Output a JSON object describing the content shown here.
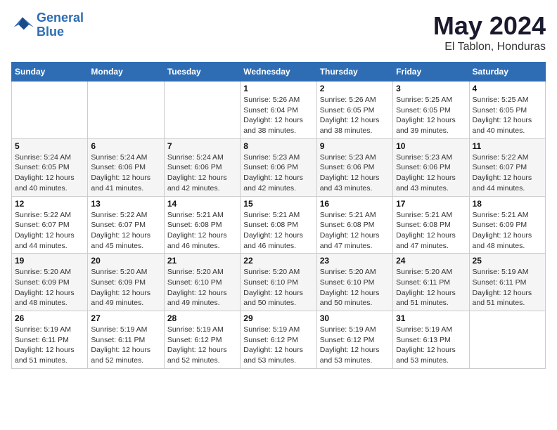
{
  "logo": {
    "line1": "General",
    "line2": "Blue"
  },
  "title": "May 2024",
  "location": "El Tablon, Honduras",
  "weekdays": [
    "Sunday",
    "Monday",
    "Tuesday",
    "Wednesday",
    "Thursday",
    "Friday",
    "Saturday"
  ],
  "weeks": [
    [
      {
        "day": "",
        "info": ""
      },
      {
        "day": "",
        "info": ""
      },
      {
        "day": "",
        "info": ""
      },
      {
        "day": "1",
        "info": "Sunrise: 5:26 AM\nSunset: 6:04 PM\nDaylight: 12 hours\nand 38 minutes."
      },
      {
        "day": "2",
        "info": "Sunrise: 5:26 AM\nSunset: 6:05 PM\nDaylight: 12 hours\nand 38 minutes."
      },
      {
        "day": "3",
        "info": "Sunrise: 5:25 AM\nSunset: 6:05 PM\nDaylight: 12 hours\nand 39 minutes."
      },
      {
        "day": "4",
        "info": "Sunrise: 5:25 AM\nSunset: 6:05 PM\nDaylight: 12 hours\nand 40 minutes."
      }
    ],
    [
      {
        "day": "5",
        "info": "Sunrise: 5:24 AM\nSunset: 6:05 PM\nDaylight: 12 hours\nand 40 minutes."
      },
      {
        "day": "6",
        "info": "Sunrise: 5:24 AM\nSunset: 6:06 PM\nDaylight: 12 hours\nand 41 minutes."
      },
      {
        "day": "7",
        "info": "Sunrise: 5:24 AM\nSunset: 6:06 PM\nDaylight: 12 hours\nand 42 minutes."
      },
      {
        "day": "8",
        "info": "Sunrise: 5:23 AM\nSunset: 6:06 PM\nDaylight: 12 hours\nand 42 minutes."
      },
      {
        "day": "9",
        "info": "Sunrise: 5:23 AM\nSunset: 6:06 PM\nDaylight: 12 hours\nand 43 minutes."
      },
      {
        "day": "10",
        "info": "Sunrise: 5:23 AM\nSunset: 6:06 PM\nDaylight: 12 hours\nand 43 minutes."
      },
      {
        "day": "11",
        "info": "Sunrise: 5:22 AM\nSunset: 6:07 PM\nDaylight: 12 hours\nand 44 minutes."
      }
    ],
    [
      {
        "day": "12",
        "info": "Sunrise: 5:22 AM\nSunset: 6:07 PM\nDaylight: 12 hours\nand 44 minutes."
      },
      {
        "day": "13",
        "info": "Sunrise: 5:22 AM\nSunset: 6:07 PM\nDaylight: 12 hours\nand 45 minutes."
      },
      {
        "day": "14",
        "info": "Sunrise: 5:21 AM\nSunset: 6:08 PM\nDaylight: 12 hours\nand 46 minutes."
      },
      {
        "day": "15",
        "info": "Sunrise: 5:21 AM\nSunset: 6:08 PM\nDaylight: 12 hours\nand 46 minutes."
      },
      {
        "day": "16",
        "info": "Sunrise: 5:21 AM\nSunset: 6:08 PM\nDaylight: 12 hours\nand 47 minutes."
      },
      {
        "day": "17",
        "info": "Sunrise: 5:21 AM\nSunset: 6:08 PM\nDaylight: 12 hours\nand 47 minutes."
      },
      {
        "day": "18",
        "info": "Sunrise: 5:21 AM\nSunset: 6:09 PM\nDaylight: 12 hours\nand 48 minutes."
      }
    ],
    [
      {
        "day": "19",
        "info": "Sunrise: 5:20 AM\nSunset: 6:09 PM\nDaylight: 12 hours\nand 48 minutes."
      },
      {
        "day": "20",
        "info": "Sunrise: 5:20 AM\nSunset: 6:09 PM\nDaylight: 12 hours\nand 49 minutes."
      },
      {
        "day": "21",
        "info": "Sunrise: 5:20 AM\nSunset: 6:10 PM\nDaylight: 12 hours\nand 49 minutes."
      },
      {
        "day": "22",
        "info": "Sunrise: 5:20 AM\nSunset: 6:10 PM\nDaylight: 12 hours\nand 50 minutes."
      },
      {
        "day": "23",
        "info": "Sunrise: 5:20 AM\nSunset: 6:10 PM\nDaylight: 12 hours\nand 50 minutes."
      },
      {
        "day": "24",
        "info": "Sunrise: 5:20 AM\nSunset: 6:11 PM\nDaylight: 12 hours\nand 51 minutes."
      },
      {
        "day": "25",
        "info": "Sunrise: 5:19 AM\nSunset: 6:11 PM\nDaylight: 12 hours\nand 51 minutes."
      }
    ],
    [
      {
        "day": "26",
        "info": "Sunrise: 5:19 AM\nSunset: 6:11 PM\nDaylight: 12 hours\nand 51 minutes."
      },
      {
        "day": "27",
        "info": "Sunrise: 5:19 AM\nSunset: 6:11 PM\nDaylight: 12 hours\nand 52 minutes."
      },
      {
        "day": "28",
        "info": "Sunrise: 5:19 AM\nSunset: 6:12 PM\nDaylight: 12 hours\nand 52 minutes."
      },
      {
        "day": "29",
        "info": "Sunrise: 5:19 AM\nSunset: 6:12 PM\nDaylight: 12 hours\nand 53 minutes."
      },
      {
        "day": "30",
        "info": "Sunrise: 5:19 AM\nSunset: 6:12 PM\nDaylight: 12 hours\nand 53 minutes."
      },
      {
        "day": "31",
        "info": "Sunrise: 5:19 AM\nSunset: 6:13 PM\nDaylight: 12 hours\nand 53 minutes."
      },
      {
        "day": "",
        "info": ""
      }
    ]
  ]
}
